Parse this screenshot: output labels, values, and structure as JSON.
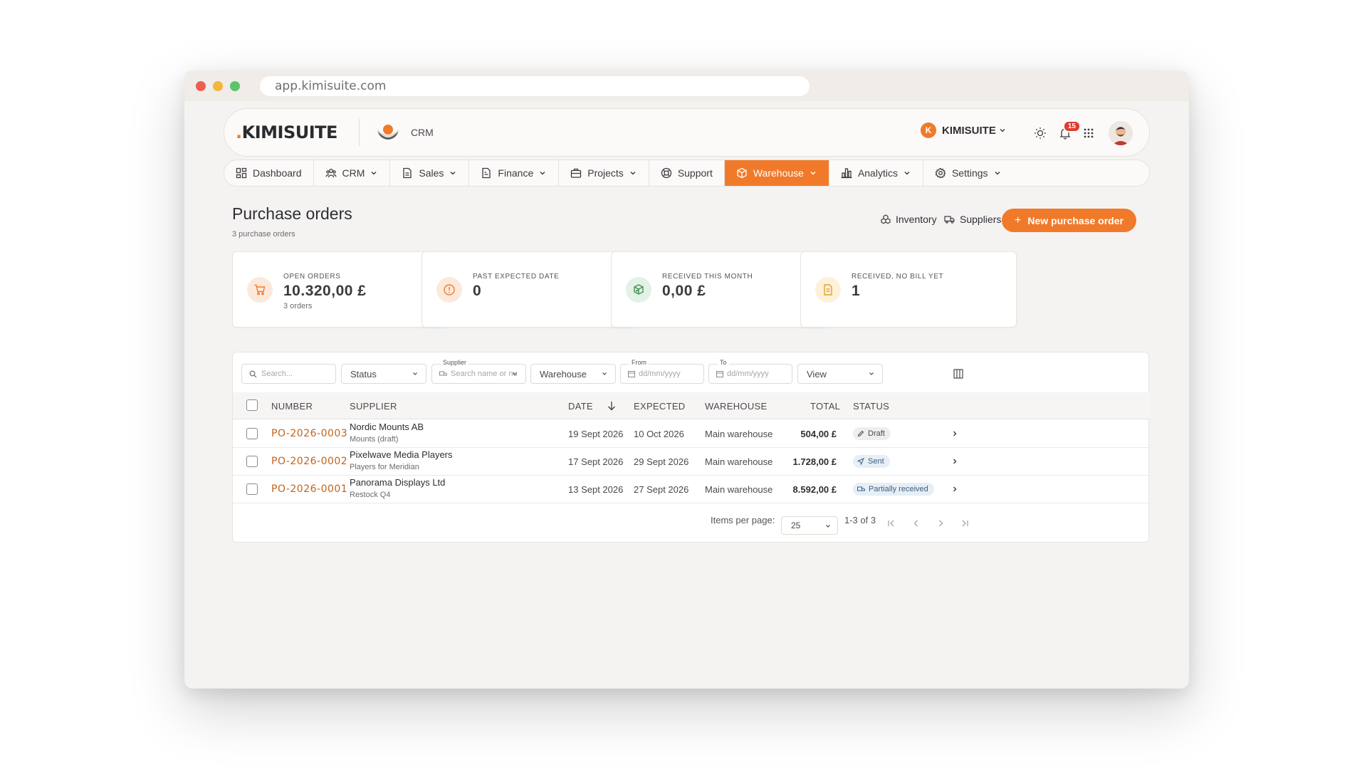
{
  "browser": {
    "url": "app.kimisuite.com"
  },
  "header": {
    "logo": "KIMISUITE",
    "logo_dot": ".",
    "app_label": "CRM",
    "org_initial": "K",
    "org_name": "KIMISUITE",
    "notification_count": "15"
  },
  "nav": {
    "items": [
      {
        "label": "Dashboard",
        "icon": "dashboard-icon"
      },
      {
        "label": "CRM",
        "icon": "users-icon"
      },
      {
        "label": "Sales",
        "icon": "document-icon"
      },
      {
        "label": "Finance",
        "icon": "file-icon"
      },
      {
        "label": "Projects",
        "icon": "briefcase-icon"
      },
      {
        "label": "Support",
        "icon": "lifebuoy-icon"
      },
      {
        "label": "Warehouse",
        "icon": "box-icon",
        "active": true
      },
      {
        "label": "Analytics",
        "icon": "bar-chart-icon"
      },
      {
        "label": "Settings",
        "icon": "gear-icon"
      }
    ]
  },
  "page": {
    "title": "Purchase orders",
    "subtitle": "3 purchase orders",
    "inventory_label": "Inventory",
    "suppliers_label": "Suppliers",
    "new_order_label": "New purchase order",
    "accent_color": "#f07a2a"
  },
  "stats": [
    {
      "label": "OPEN ORDERS",
      "value": "10.320,00 £",
      "sub": "3 orders"
    },
    {
      "label": "PAST EXPECTED DATE",
      "value": "0"
    },
    {
      "label": "RECEIVED THIS MONTH",
      "value": "0,00 £"
    },
    {
      "label": "RECEIVED, NO BILL YET",
      "value": "1"
    }
  ],
  "filters": {
    "search_placeholder": "Search...",
    "status": "Status",
    "supplier_label": "Supplier",
    "supplier_placeholder": "Search name or nu",
    "warehouse": "Warehouse",
    "from_label": "From",
    "from_placeholder": "dd/mm/yyyy",
    "to_label": "To",
    "to_placeholder": "dd/mm/yyyy",
    "view": "View"
  },
  "table": {
    "columns": [
      "NUMBER",
      "SUPPLIER",
      "DATE",
      "EXPECTED",
      "WAREHOUSE",
      "TOTAL",
      "STATUS"
    ],
    "rows": [
      {
        "number": "PO-2026-0003",
        "supplier": "Nordic Mounts AB",
        "note": "Mounts (draft)",
        "date": "19 Sept 2026",
        "expected": "10 Oct 2026",
        "warehouse": "Main warehouse",
        "total": "504,00 £",
        "status": "Draft"
      },
      {
        "number": "PO-2026-0002",
        "supplier": "Pixelwave Media Players",
        "note": "Players for Meridian",
        "date": "17 Sept 2026",
        "expected": "29 Sept 2026",
        "warehouse": "Main warehouse",
        "total": "1.728,00 £",
        "status": "Sent"
      },
      {
        "number": "PO-2026-0001",
        "supplier": "Panorama Displays Ltd",
        "note": "Restock Q4",
        "date": "13 Sept 2026",
        "expected": "27 Sept 2026",
        "warehouse": "Main warehouse",
        "total": "8.592,00 £",
        "status": "Partially received"
      }
    ]
  },
  "pagination": {
    "items_per_page_label": "Items per page:",
    "items_per_page": "25",
    "range": "1-3 of 3"
  }
}
